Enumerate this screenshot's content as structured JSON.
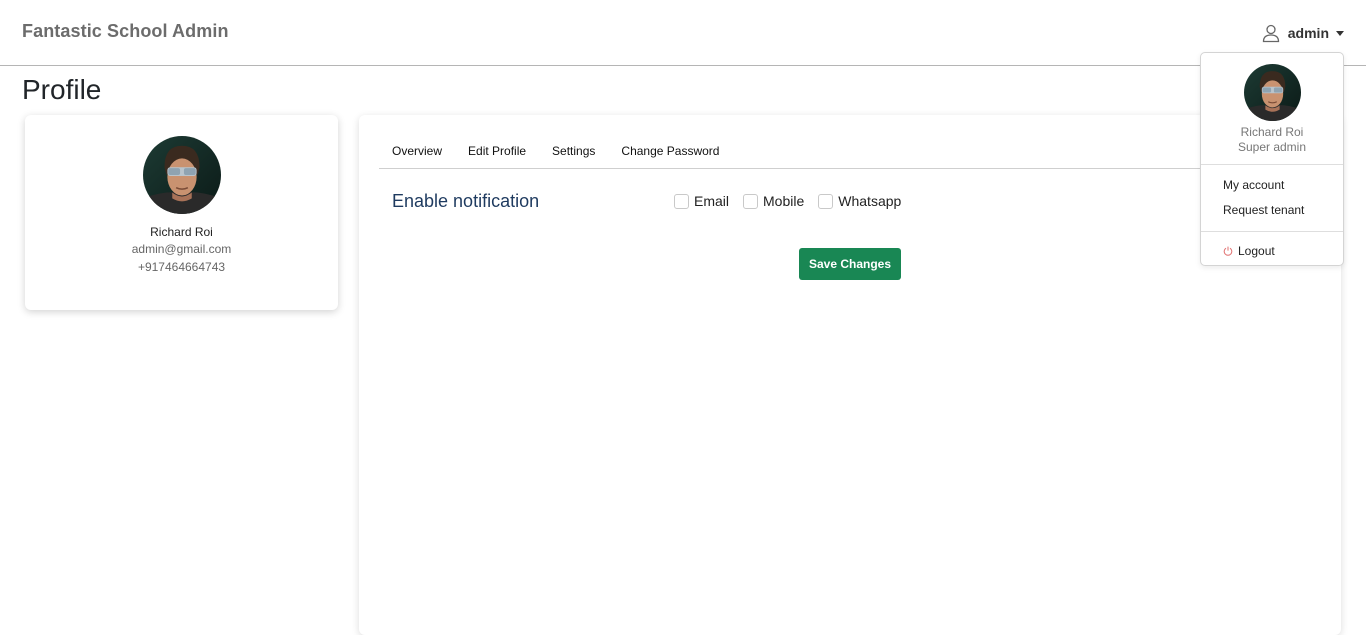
{
  "navbar": {
    "brand": "Fantastic School Admin",
    "user_label": "admin"
  },
  "page": {
    "title": "Profile"
  },
  "profile_card": {
    "name": "Richard Roi",
    "email": "admin@gmail.com",
    "phone": "+917464664743"
  },
  "tabs": [
    {
      "label": "Overview"
    },
    {
      "label": "Edit Profile"
    },
    {
      "label": "Settings"
    },
    {
      "label": "Change Password"
    }
  ],
  "settings": {
    "notification_label": "Enable notification",
    "options": [
      {
        "label": "Email",
        "checked": false
      },
      {
        "label": "Mobile",
        "checked": false
      },
      {
        "label": "Whatsapp",
        "checked": false
      }
    ],
    "save_label": "Save Changes"
  },
  "dropdown": {
    "name": "Richard Roi",
    "role": "Super admin",
    "items": [
      {
        "label": "My account"
      },
      {
        "label": "Request tenant"
      }
    ],
    "logout_label": "Logout"
  },
  "colors": {
    "accent_green": "#198754",
    "heading_navy": "#1e3a5f",
    "logout_icon": "#e07070"
  },
  "icons": {
    "user": "user-icon",
    "caret": "caret-down-icon",
    "power": "power-icon"
  }
}
